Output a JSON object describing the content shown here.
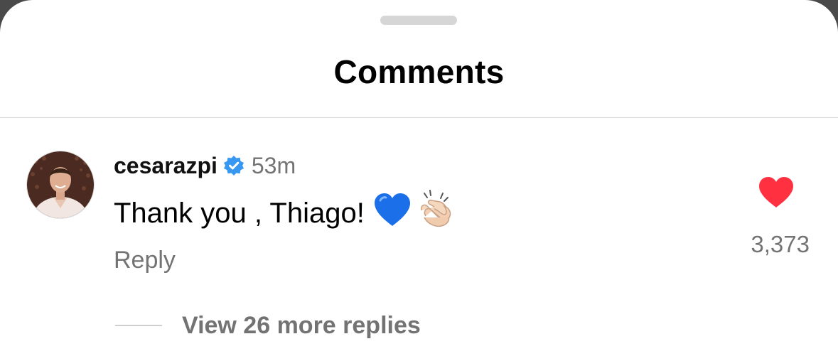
{
  "sheet": {
    "title": "Comments"
  },
  "comment": {
    "username": "cesarazpi",
    "verified": true,
    "time": "53m",
    "text": "Thank you , Thiago!",
    "emojis": [
      "blue-heart",
      "clapping-hands"
    ],
    "reply_label": "Reply",
    "liked": true,
    "like_count": "3,373",
    "view_replies_label": "View 26 more replies"
  },
  "colors": {
    "verified_blue": "#3897f0",
    "like_red": "#ff3040",
    "secondary_text": "#737373",
    "divider": "#dbdbdb",
    "blue_heart": "#1a73e8"
  }
}
